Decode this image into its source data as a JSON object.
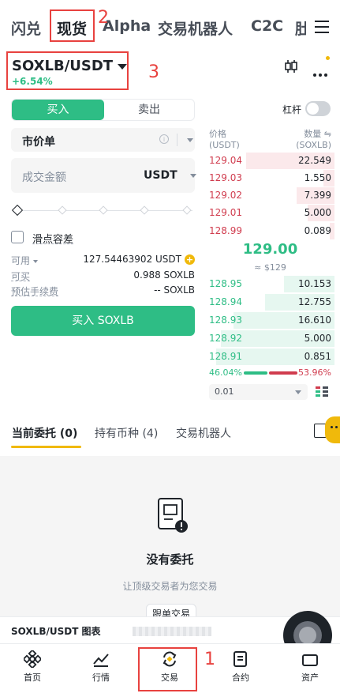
{
  "top_tabs": [
    "闪兑",
    "现货",
    "Alpha",
    "交易机器人",
    "C2C",
    "肚"
  ],
  "annotations": {
    "a1": "1",
    "a2": "2",
    "a3": "3"
  },
  "pair": {
    "symbol": "SOXLB/USDT",
    "change": "+6.54%"
  },
  "form": {
    "buy_tab": "买入",
    "sell_tab": "卖出",
    "leverage_label": "杠杆",
    "order_type": "市价单",
    "amount_placeholder": "成交金额",
    "amount_unit": "USDT",
    "slippage_label": "滑点容差",
    "available_label": "可用",
    "available_value": "127.54463902 USDT",
    "buyable_label": "可买",
    "buyable_value": "0.988 SOXLB",
    "fee_label": "预估手续费",
    "fee_value": "-- SOXLB",
    "buy_button": "买入 SOXLB"
  },
  "orderbook": {
    "price_label": "价格",
    "price_unit": "(USDT)",
    "qty_label": "数量 ⇋",
    "qty_unit": "(SOXLB)",
    "asks": [
      {
        "price": "129.04",
        "qty": "22.549"
      },
      {
        "price": "129.03",
        "qty": "1.550"
      },
      {
        "price": "129.02",
        "qty": "7.399"
      },
      {
        "price": "129.01",
        "qty": "5.000"
      },
      {
        "price": "128.99",
        "qty": "0.089"
      }
    ],
    "last_price": "129.00",
    "fiat_price": "≈ $129",
    "bids": [
      {
        "price": "128.95",
        "qty": "10.153"
      },
      {
        "price": "128.94",
        "qty": "12.755"
      },
      {
        "price": "128.93",
        "qty": "16.610"
      },
      {
        "price": "128.92",
        "qty": "5.000"
      },
      {
        "price": "128.91",
        "qty": "0.851"
      }
    ],
    "buy_pct": "46.04%",
    "sell_pct": "53.96%",
    "buy_ratio": 0.4604,
    "precision": "0.01"
  },
  "bottom_tabs": [
    "当前委托 (0)",
    "持有币种 (4)",
    "交易机器人"
  ],
  "empty": {
    "title": "没有委托",
    "subtitle": "让顶级交易者为您交易",
    "button": "跟单交易"
  },
  "chart_bar_label": "SOXLB/USDT 图表",
  "nav": [
    "首页",
    "行情",
    "交易",
    "合约",
    "资产"
  ],
  "colors": {
    "green": "#2ebd85",
    "red": "#d03c4e",
    "accent": "#f0b90b",
    "annotation": "#e8423f"
  }
}
